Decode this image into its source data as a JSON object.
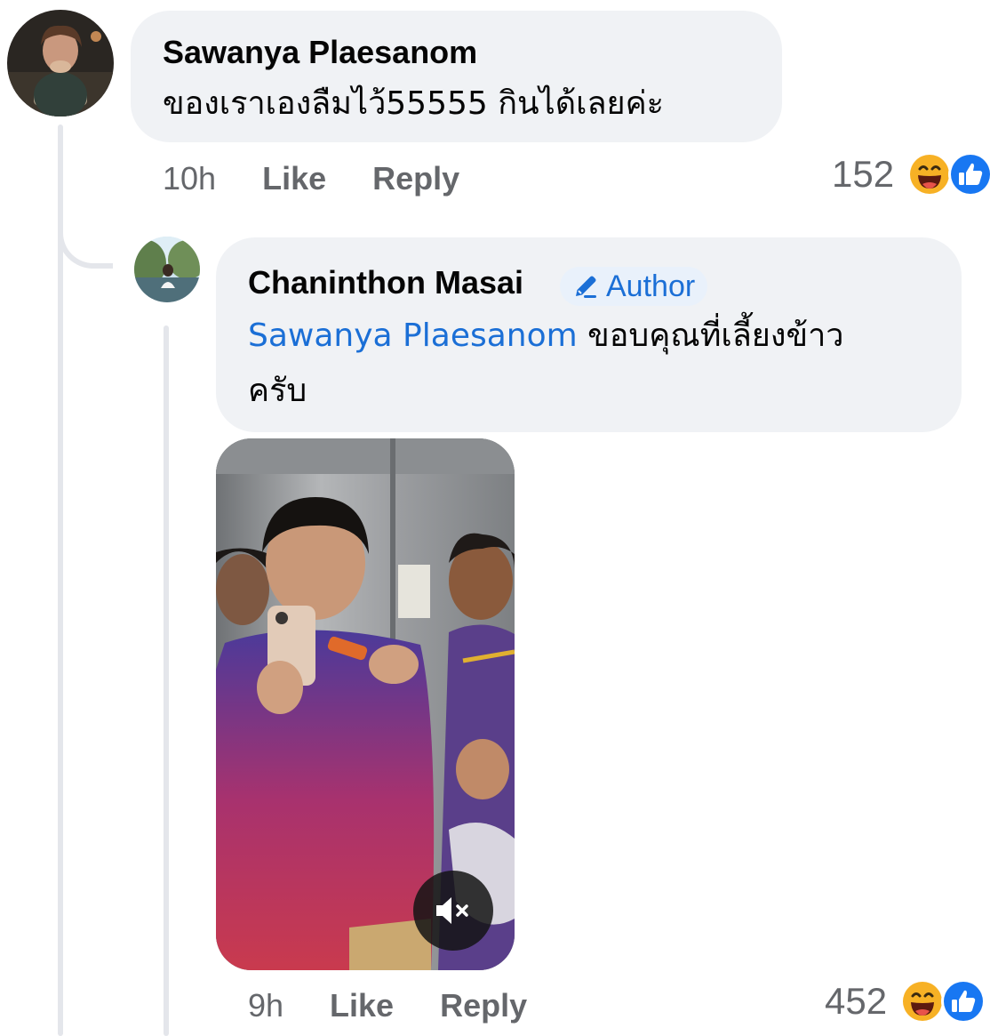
{
  "colors": {
    "bubble_bg": "#f0f2f5",
    "mention": "#1b6fd6",
    "meta_text": "#65676b",
    "like_blue": "#1877f2",
    "haha_yellow": "#f7b125"
  },
  "comment": {
    "author": "Sawanya Plaesanom",
    "text": "ของเราเองลืมไว้55555 กินได้เลยค่ะ",
    "time": "10h",
    "like_label": "Like",
    "reply_label": "Reply",
    "reaction_count": "152",
    "reactions": [
      "haha-icon",
      "like-icon"
    ]
  },
  "reply": {
    "author": "Chaninthon Masai",
    "badge": "Author",
    "mention": "Sawanya Plaesanom",
    "text_line1": " ขอบคุณที่เลี้ยงข้าว",
    "text_line2": "ครับ",
    "time": "9h",
    "like_label": "Like",
    "reply_label": "Reply",
    "reaction_count": "452",
    "reactions": [
      "haha-icon",
      "like-icon"
    ],
    "video": {
      "muted": true,
      "control_icon": "speaker-muted-icon"
    }
  }
}
